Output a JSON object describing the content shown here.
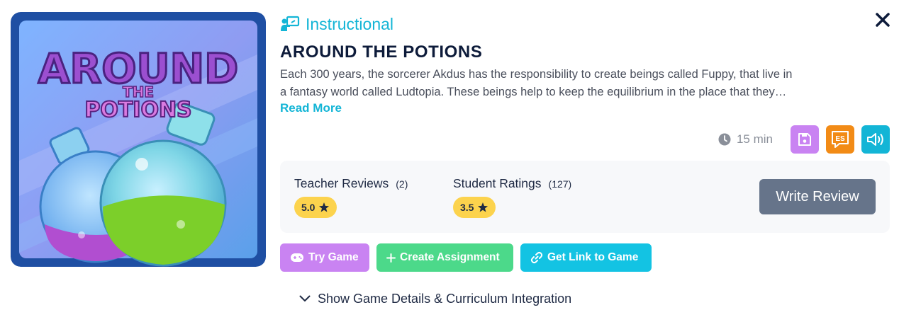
{
  "game": {
    "category": "Instructional",
    "title": "AROUND THE POTIONS",
    "description_line1": "Each 300 years, the sorcerer Akdus has the responsibility to create beings called Fuppy, that live in",
    "description_line2": "a fantasy world called Ludtopia. These beings help to keep the equilibrium in the place that they…",
    "read_more": "Read More",
    "thumbnail_logo_line1": "AROUND",
    "thumbnail_logo_line2": "THE",
    "thumbnail_logo_line3": "POTIONS"
  },
  "meta": {
    "duration": "15 min",
    "language_code": "ES"
  },
  "reviews": {
    "teacher_label": "Teacher Reviews",
    "teacher_count": "(2)",
    "teacher_rating": "5.0",
    "student_label": "Student Ratings",
    "student_count": "(127)",
    "student_rating": "3.5",
    "write_review": "Write Review"
  },
  "actions": {
    "try_game": "Try Game",
    "create_assignment": "Create Assignment",
    "get_link": "Get Link to Game"
  },
  "details_toggle": "Show Game Details & Curriculum Integration",
  "colors": {
    "accent": "#13b5d6",
    "purple": "#c983f2",
    "orange": "#f28b16",
    "green": "#4cd98a",
    "star_badge": "#fcd34d",
    "write_review_bg": "#66748a"
  },
  "icons": [
    "close-icon",
    "instructional-icon",
    "clock-icon",
    "save-icon",
    "language-icon",
    "audio-icon",
    "star-icon",
    "gamepad-icon",
    "plus-icon",
    "link-icon",
    "chevron-down-icon"
  ]
}
